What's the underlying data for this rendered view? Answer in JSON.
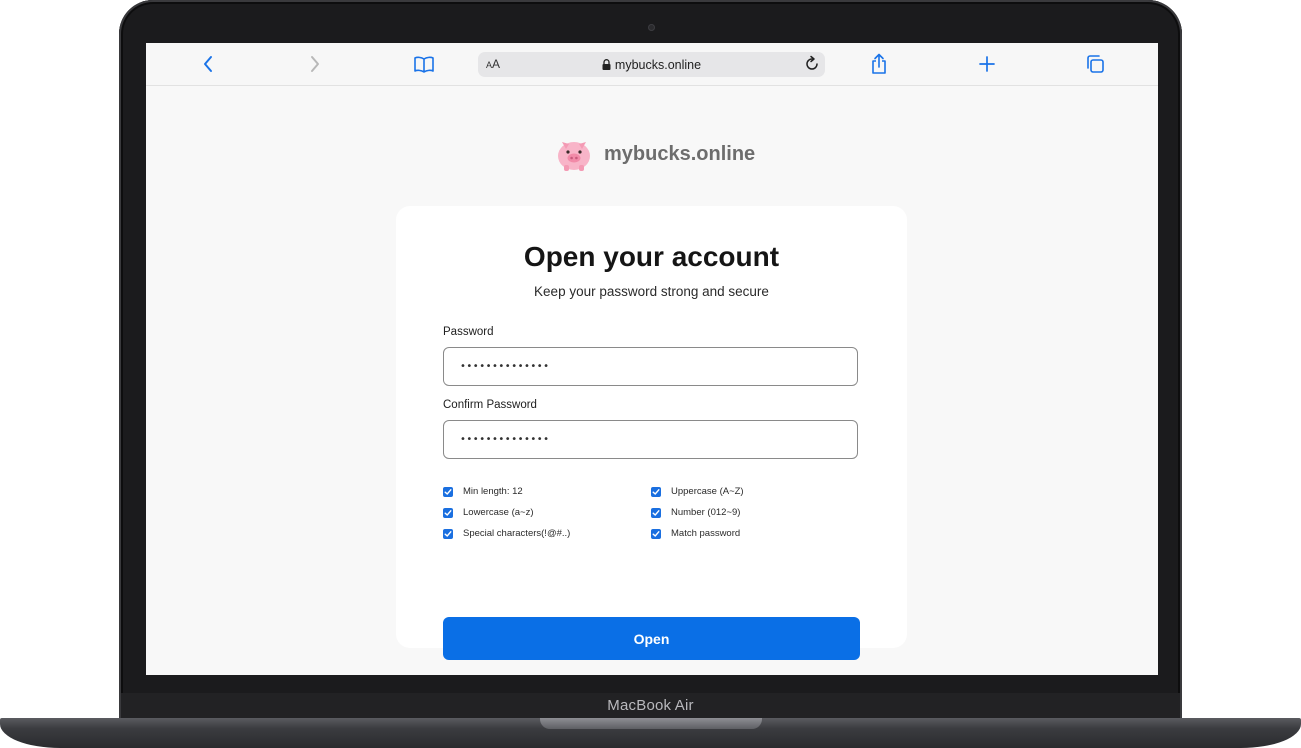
{
  "device": {
    "label": "MacBook Air"
  },
  "browser": {
    "text_size_label": "AA",
    "url": "mybucks.online",
    "icons": [
      "back-icon",
      "forward-icon",
      "bookmarks-icon",
      "lock-icon",
      "reload-icon",
      "share-icon",
      "new-tab-icon",
      "tabs-icon"
    ]
  },
  "brand": {
    "name": "mybucks.online",
    "logo": "piggy-bank-icon"
  },
  "form": {
    "title": "Open your account",
    "subtitle": "Keep your password strong and secure",
    "password_label": "Password",
    "password_value": "••••••••••••••",
    "confirm_label": "Confirm Password",
    "confirm_value": "••••••••••••••",
    "rules": [
      {
        "label": "Min length: 12",
        "checked": true
      },
      {
        "label": "Uppercase (A~Z)",
        "checked": true
      },
      {
        "label": "Lowercase (a~z)",
        "checked": true
      },
      {
        "label": "Number (012~9)",
        "checked": true
      },
      {
        "label": "Special characters(!@#..)",
        "checked": true
      },
      {
        "label": "Match password",
        "checked": true
      }
    ],
    "submit_label": "Open"
  },
  "colors": {
    "accent": "#0a6fe6",
    "checkbox": "#1a6fe0",
    "page_background": "#f8f8f8",
    "brand_text": "#6d6d6d",
    "ios_blue": "#1a73e8"
  }
}
